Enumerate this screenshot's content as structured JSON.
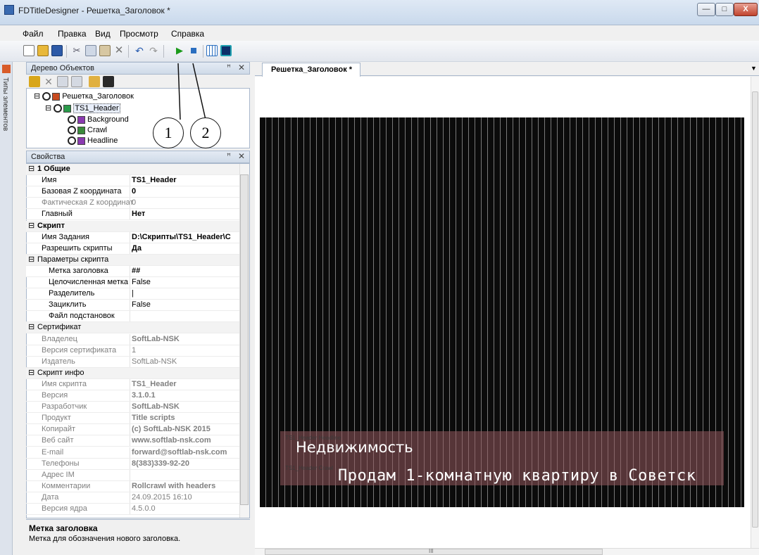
{
  "window": {
    "title": "FDTitleDesigner - Решетка_Заголовок *",
    "controls": [
      "—",
      "□",
      "X"
    ]
  },
  "menu": [
    "Файл",
    "Правка",
    "Вид",
    "Просмотр",
    "Справка"
  ],
  "left_tab": "Типы элементов",
  "object_tree": {
    "title": "Дерево Объектов",
    "nodes": [
      "Решетка_Заголовок",
      "TS1_Header",
      "Background",
      "Crawl",
      "Headline"
    ]
  },
  "callouts": [
    "1",
    "2"
  ],
  "properties": {
    "title": "Свойства",
    "rows": [
      {
        "cat": "1 Общие"
      },
      {
        "name": "Имя",
        "value": "TS1_Header",
        "bold": true
      },
      {
        "name": "Базовая Z координата",
        "value": "0",
        "bold": true
      },
      {
        "name": "Фактическая Z координат",
        "value": "0",
        "grey": true
      },
      {
        "name": "Главный",
        "value": "Нет",
        "bold": true
      },
      {
        "cat": "Скрипт"
      },
      {
        "name": "Имя Задания",
        "value": "D:\\Скрипты\\TS1_Header\\C",
        "bold": true
      },
      {
        "name": "Разрешить скрипты",
        "value": "Да",
        "bold": true
      },
      {
        "cat": "Параметры скрипта",
        "normal": true
      },
      {
        "name": "Метка заголовка",
        "value": "##",
        "bold": true,
        "indent": true,
        "selected": true
      },
      {
        "name": "Целочисленная метка",
        "value": "False",
        "indent": true
      },
      {
        "name": "Разделитель",
        "value": "|",
        "indent": true
      },
      {
        "name": "Зациклить",
        "value": "False",
        "indent": true
      },
      {
        "name": "Файл подстановок",
        "value": "",
        "indent": true
      },
      {
        "cat": "Сертификат",
        "normal": true
      },
      {
        "name": "Владелец",
        "value": "SoftLab-NSK",
        "bold": true,
        "grey": true
      },
      {
        "name": "Версия сертификата",
        "value": "1",
        "grey": true
      },
      {
        "name": "Издатель",
        "value": "SoftLab-NSK",
        "grey": true
      },
      {
        "cat": "Скрипт инфо",
        "normal": true
      },
      {
        "name": "Имя скрипта",
        "value": "TS1_Header",
        "bold": true,
        "grey": true
      },
      {
        "name": "Версия",
        "value": "3.1.0.1",
        "bold": true,
        "grey": true
      },
      {
        "name": "Разработчик",
        "value": "SoftLab-NSK",
        "bold": true,
        "grey": true
      },
      {
        "name": "Продукт",
        "value": "Title scripts",
        "bold": true,
        "grey": true
      },
      {
        "name": "Копирайт",
        "value": "(c) SoftLab-NSK 2015",
        "bold": true,
        "grey": true
      },
      {
        "name": "Веб сайт",
        "value": "www.softlab-nsk.com",
        "bold": true,
        "grey": true
      },
      {
        "name": "E-mail",
        "value": "forward@softlab-nsk.com",
        "bold": true,
        "grey": true
      },
      {
        "name": "Телефоны",
        "value": "8(383)339-92-20",
        "bold": true,
        "grey": true
      },
      {
        "name": "Адрес IM",
        "value": "",
        "grey": true
      },
      {
        "name": "Комментарии",
        "value": "Rollcrawl with headers",
        "bold": true,
        "grey": true
      },
      {
        "name": "Дата",
        "value": "24.09.2015 16:10",
        "grey": true
      },
      {
        "name": "Версия ядра",
        "value": "4.5.0.0",
        "grey": true
      }
    ]
  },
  "description": {
    "title": "Метка заголовка",
    "text": "Метка для обозначения нового заголовка."
  },
  "document": {
    "tab": "Решетка_Заголовок *",
    "headline_label": "TS1_Header Headline",
    "crawl_label": "TS1_Header Crawl",
    "headline": "Недвижимость",
    "crawl": "Продам 1-комнатную квартиру в Советск"
  },
  "scroll_glyph": "III"
}
